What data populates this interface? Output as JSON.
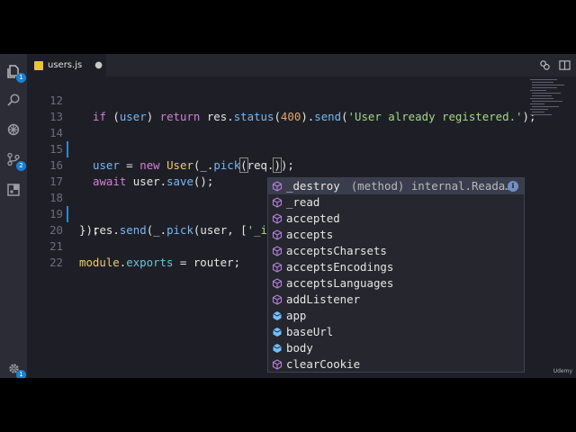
{
  "window": {
    "tab": {
      "title": "users.js",
      "modified_marker": "●"
    },
    "watermark": "Udemy"
  },
  "activity_bar": {
    "explorer_badge": "1",
    "source_control_badge": "2",
    "settings_badge": "1"
  },
  "editor": {
    "line_numbers": [
      "12",
      "13",
      "14",
      "15",
      "16",
      "17",
      "18",
      "19",
      "20",
      "21",
      "22"
    ],
    "lines": {
      "l12": {
        "t1": "if",
        "t2": " (",
        "t3": "user",
        "t4": ") ",
        "t5": "return",
        "t6": " res.",
        "t7": "status",
        "t8": "(",
        "t9": "400",
        "t10": ").",
        "t11": "send",
        "t12": "(",
        "t13": "'User already registered.'",
        "t14": ");"
      },
      "l14": {
        "t1": "user",
        "t2": " = ",
        "t3": "new",
        "t4": " ",
        "t5": "User",
        "t6": "(_.",
        "t7": "pick",
        "t8": "(",
        "t9": "req.",
        "t10": ")",
        "t11": ");"
      },
      "l16": {
        "t1": "await",
        "t2": " user.",
        "t3": "save",
        "t4": "();"
      },
      "l18": {
        "t1": "res.",
        "t2": "send",
        "t3": "(_.",
        "t4": "pick",
        "t5": "(user, [",
        "t6": "'_id"
      },
      "l19": {
        "t1": "});"
      },
      "l21": {
        "t1": "module",
        "t2": ".",
        "t3": "exports",
        "t4": " = router;"
      }
    }
  },
  "suggestions": {
    "info_label": "i",
    "items": [
      {
        "label": "_destroy",
        "detail": "(method) internal.Reada…",
        "kind": "method"
      },
      {
        "label": "_read",
        "kind": "method"
      },
      {
        "label": "accepted",
        "kind": "method"
      },
      {
        "label": "accepts",
        "kind": "method"
      },
      {
        "label": "acceptsCharsets",
        "kind": "method"
      },
      {
        "label": "acceptsEncodings",
        "kind": "method"
      },
      {
        "label": "acceptsLanguages",
        "kind": "method"
      },
      {
        "label": "addListener",
        "kind": "method"
      },
      {
        "label": "app",
        "kind": "field"
      },
      {
        "label": "baseUrl",
        "kind": "field"
      },
      {
        "label": "body",
        "kind": "field"
      },
      {
        "label": "clearCookie",
        "kind": "method"
      }
    ]
  },
  "colors": {
    "keyword": "#d181d4",
    "function": "#79b6f2",
    "class": "#eacb6e",
    "number": "#e5a370",
    "string": "#a6d784",
    "property": "#6fc1d6",
    "method_icon": "#b180d7",
    "field_icon": "#75beff",
    "badge": "#1b80d6"
  }
}
